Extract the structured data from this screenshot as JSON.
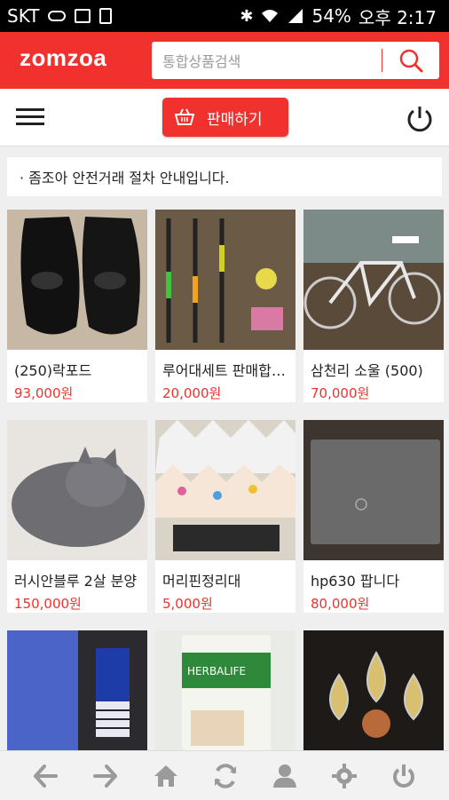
{
  "status_bar": {
    "carrier": "SKT",
    "battery": "54%",
    "time": "오후 2:17"
  },
  "header": {
    "logo": "zomzoa",
    "search_placeholder": "통합상품검색"
  },
  "menu": {
    "sell_label": "판매하기"
  },
  "notice": "· 좀조아 안전거래 절차 안내입니다.",
  "products": [
    {
      "title": "(250)락포드",
      "price": "93,000원"
    },
    {
      "title": "루어대세트 판매합니다",
      "price": "20,000원"
    },
    {
      "title": "삼천리 소울 (500)",
      "price": "70,000원"
    },
    {
      "title": "러시안블루 2살 분양",
      "price": "150,000원"
    },
    {
      "title": "머리핀정리대",
      "price": "5,000원"
    },
    {
      "title": "hp630 팝니다",
      "price": "80,000원"
    },
    {
      "title": "",
      "price": ""
    },
    {
      "title": "",
      "price": ""
    },
    {
      "title": "",
      "price": ""
    }
  ],
  "product_images": [
    "black-loafers",
    "fishing-rods",
    "bicycle",
    "gray-cat",
    "hairpin-holders",
    "laptop",
    "blue-dress",
    "herbalife-jar",
    "earrings"
  ],
  "product_image_text": {
    "herbalife": "HERBALIFE"
  },
  "bottom_nav": [
    "back-icon",
    "forward-icon",
    "home-icon",
    "refresh-icon",
    "user-icon",
    "settings-icon",
    "power-icon"
  ],
  "colors": {
    "accent": "#f0312e",
    "price": "#f0312e"
  }
}
